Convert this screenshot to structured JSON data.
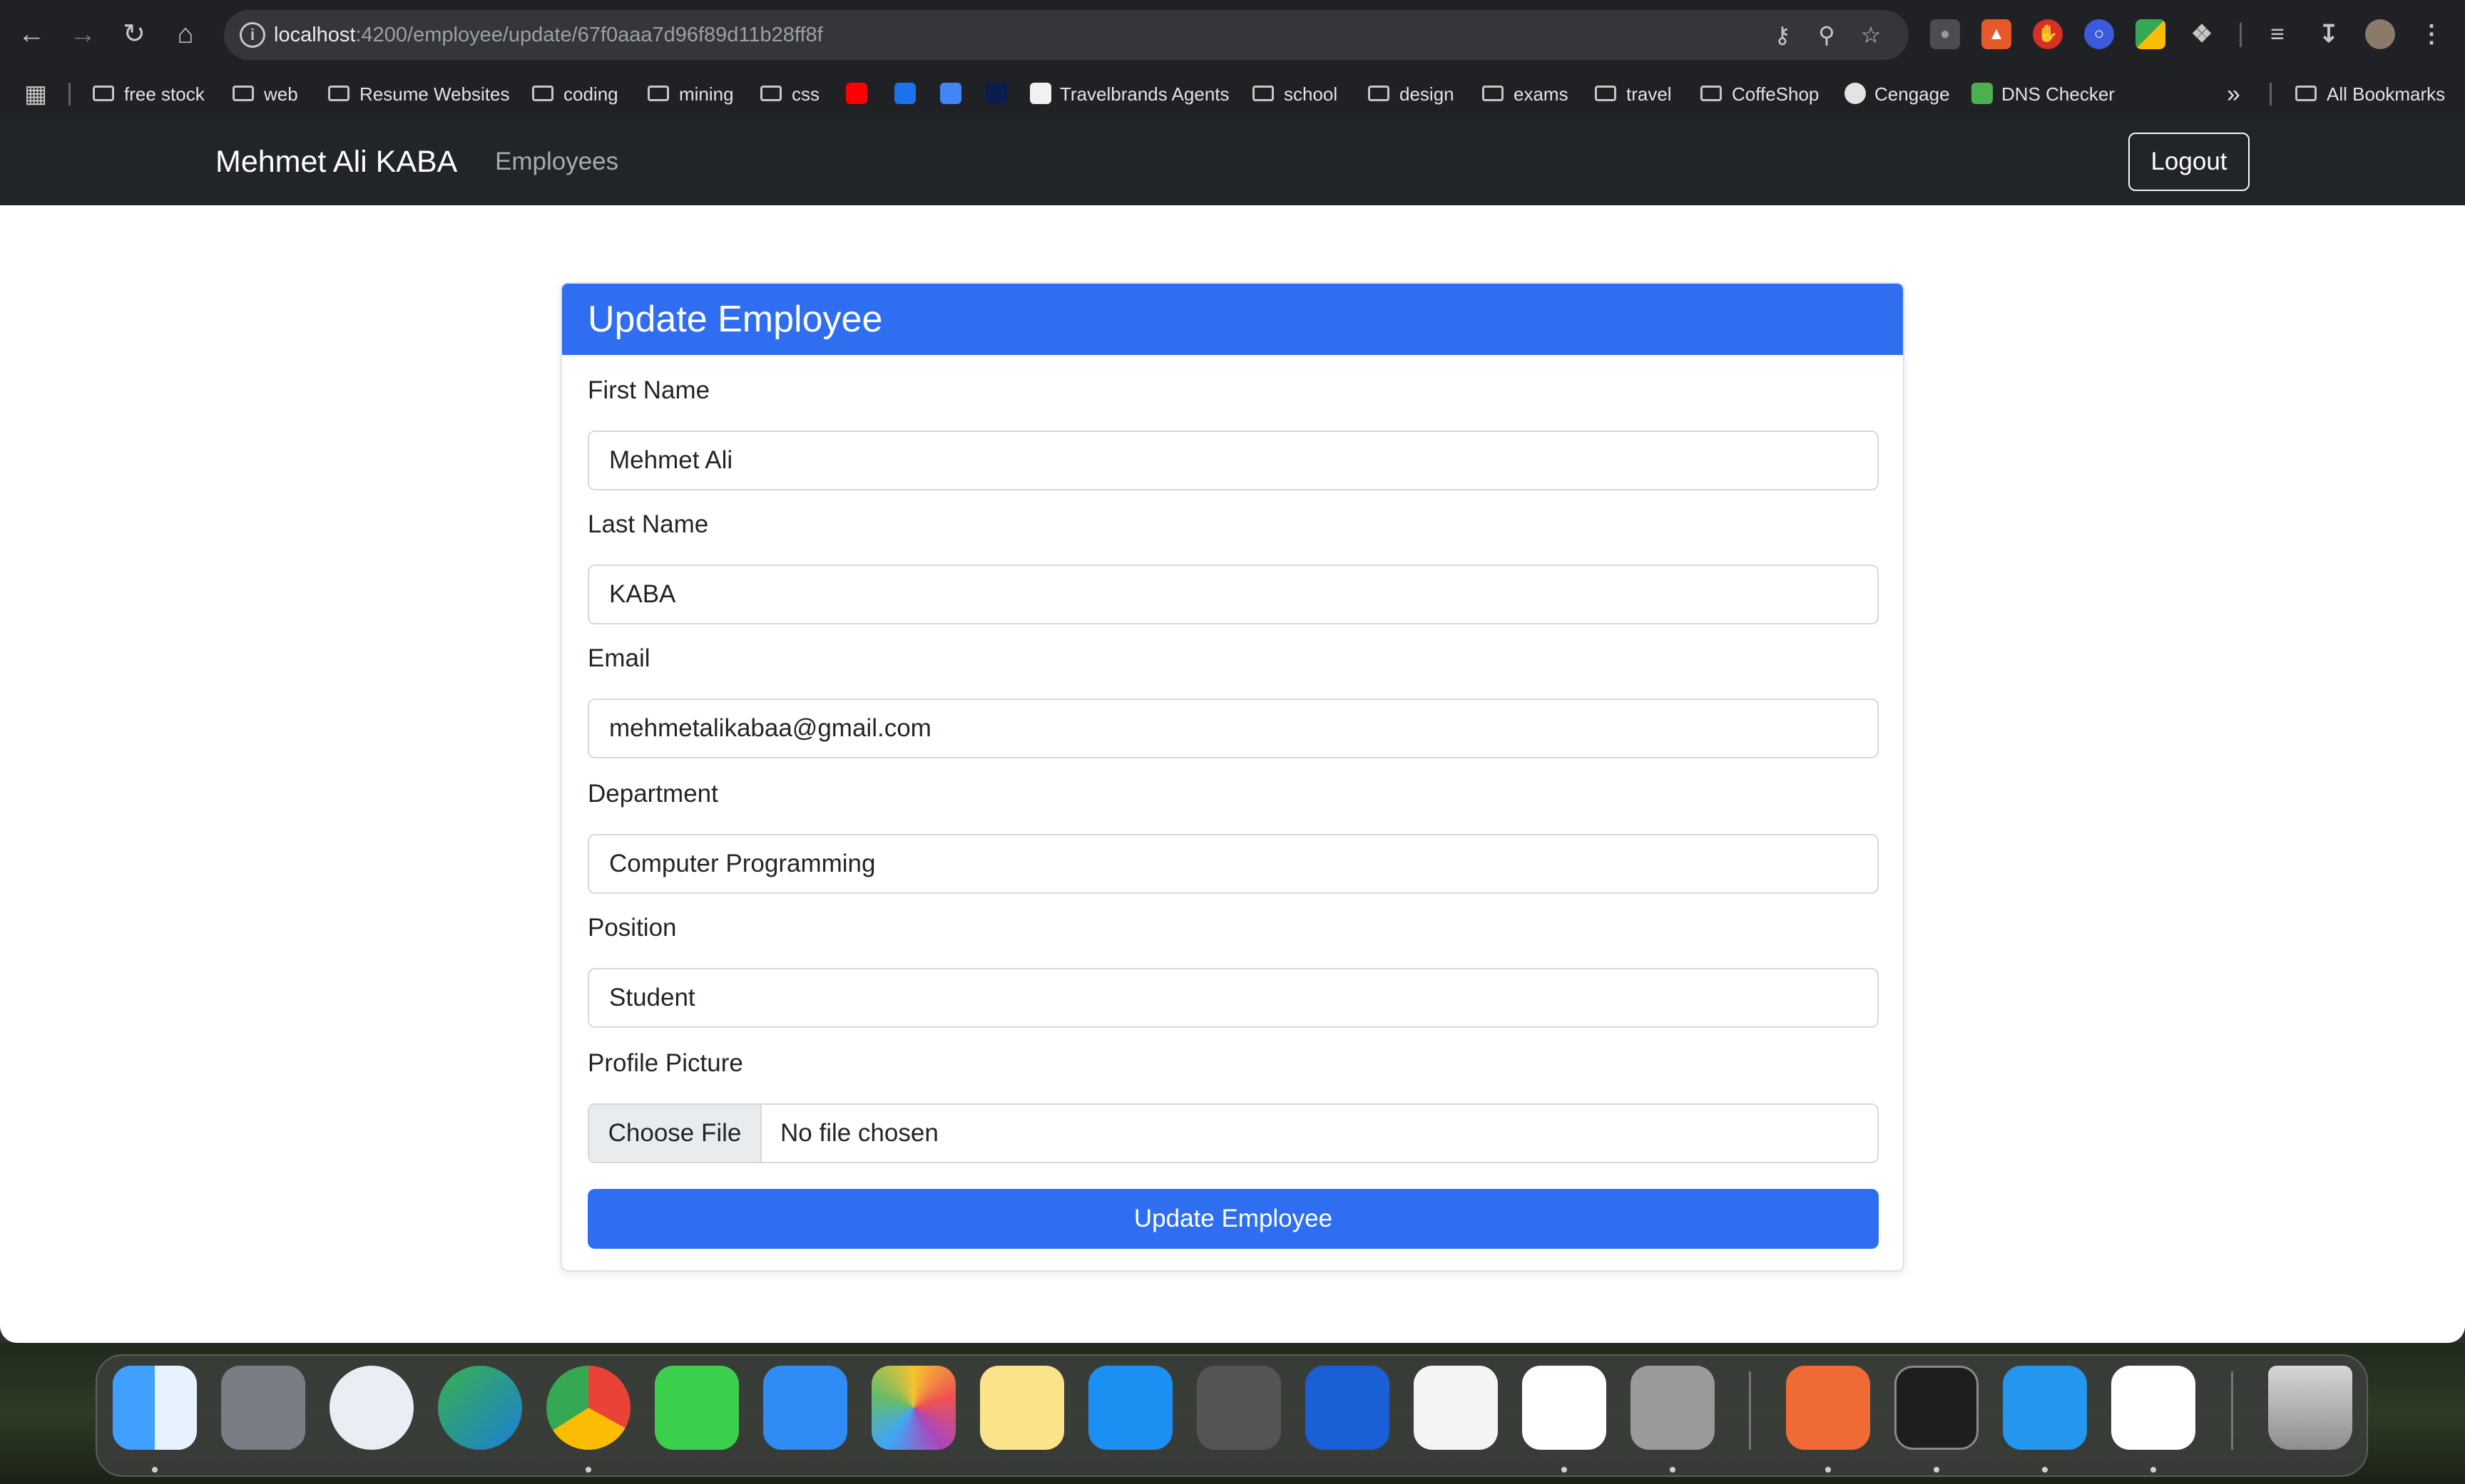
{
  "browser": {
    "url_host": "localhost",
    "url_path": ":4200/employee/update/67f0aaa7d96f89d11b28ff8f",
    "bookmarks": [
      "free stock",
      "web",
      "Resume Websites",
      "coding",
      "mining",
      "css",
      "Travelbrands Agents",
      "school",
      "design",
      "exams",
      "travel",
      "CoffeShop",
      "Cengage",
      "DNS Checker"
    ],
    "all_bookmarks": "All Bookmarks",
    "more": "»"
  },
  "app": {
    "brand": "Mehmet Ali KABA",
    "nav_employees": "Employees",
    "logout": "Logout"
  },
  "form": {
    "title": "Update Employee",
    "fields": [
      {
        "label": "First Name",
        "value": "Mehmet Ali"
      },
      {
        "label": "Last Name",
        "value": "KABA"
      },
      {
        "label": "Email",
        "value": "mehmetalikabaa@gmail.com"
      },
      {
        "label": "Department",
        "value": "Computer Programming"
      },
      {
        "label": "Position",
        "value": "Student"
      }
    ],
    "file": {
      "label": "Profile Picture",
      "button": "Choose File",
      "status": "No file chosen"
    },
    "submit": "Update Employee"
  },
  "dock": {
    "apps": [
      "finder",
      "launchpad",
      "safari",
      "edge",
      "chrome",
      "messages",
      "mail",
      "photos",
      "notes",
      "app-store",
      "calculator",
      "xcode",
      "instruments",
      "vscode",
      "simulator",
      "postman",
      "terminal",
      "docker",
      "word",
      "trash"
    ],
    "colors": {
      "accent": "#2f6ef0",
      "navbar": "#212529"
    }
  }
}
